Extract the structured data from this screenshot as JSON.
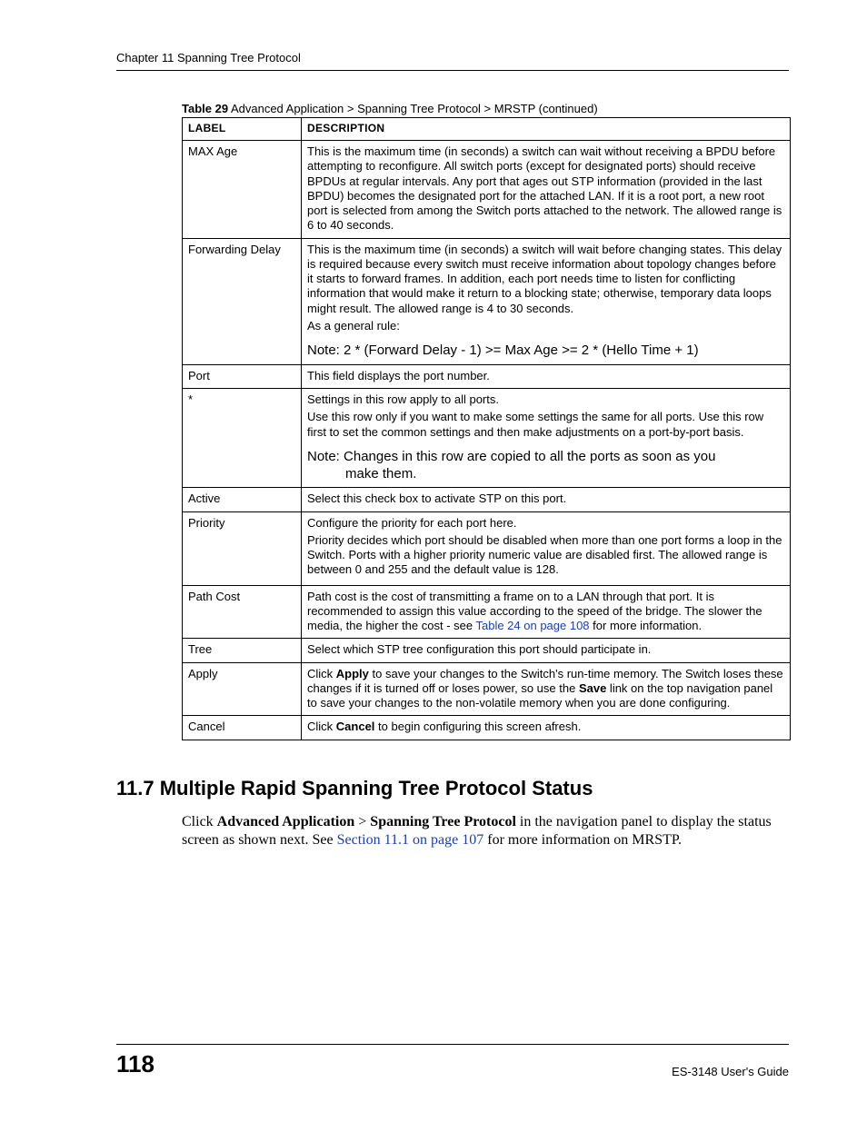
{
  "header": {
    "running": "Chapter 11 Spanning Tree Protocol"
  },
  "table": {
    "caption_bold": "Table 29",
    "caption_rest": "   Advanced Application > Spanning Tree Protocol > MRSTP  (continued)",
    "head_label": "LABEL",
    "head_desc": "DESCRIPTION",
    "rows": [
      {
        "label": "MAX Age",
        "desc_plain": "This is the maximum time (in seconds) a switch can wait without receiving a BPDU before attempting to reconfigure. All switch ports (except for designated ports) should receive BPDUs at regular intervals. Any port that ages out STP information (provided in the last BPDU) becomes the designated port for the attached LAN. If it is a root port, a new root port is selected from among the Switch ports attached to the network. The allowed range is 6 to 40 seconds."
      },
      {
        "label": "Forwarding Delay",
        "desc_p1": "This is the maximum time (in seconds) a switch will wait before changing states. This delay is required because every switch must receive information about topology changes before it starts to forward frames. In addition, each port needs time to listen for conflicting information that would make it return to a blocking state; otherwise, temporary data loops might result. The allowed range is 4 to 30 seconds.",
        "desc_p2": "As a general rule:",
        "note": "Note: 2 * (Forward Delay - 1) >= Max Age >= 2 * (Hello Time + 1)"
      },
      {
        "label": "Port",
        "desc_plain": "This field displays the port number."
      },
      {
        "label": "*",
        "desc_p1": "Settings in this row apply to all ports.",
        "desc_p2": "Use this row only if you want to make some settings the same for all ports. Use this row first to set the common settings and then make adjustments on a port-by-port basis.",
        "note_l1": "Note: Changes in this row are copied to all the ports as soon as you",
        "note_l2": "make them."
      },
      {
        "label": "Active",
        "desc_plain": "Select this check box to activate STP on this port."
      },
      {
        "label": "Priority",
        "desc_p1": "Configure the priority for each port here.",
        "desc_p2": "Priority decides which port should be disabled when more than one port forms a loop in the Switch. Ports with a higher priority numeric value are disabled first. The allowed range is between 0 and 255 and the default value is 128."
      },
      {
        "label": "Path Cost",
        "desc_pre": "Path cost is the cost of transmitting a frame on to a LAN through that port. It is recommended to assign this value according to the speed of the bridge. The slower the media, the higher the cost - see ",
        "link": "Table 24 on page 108",
        "desc_post": " for more information."
      },
      {
        "label": "Tree",
        "desc_plain": "Select which STP tree configuration this port should participate in."
      },
      {
        "label": "Apply",
        "pre1": "Click ",
        "b1": "Apply",
        "mid1": " to save your changes to the Switch's run-time memory. The Switch loses these changes if it is turned off or loses power, so use the ",
        "b2": "Save",
        "post1": " link on the top navigation panel to save your changes to the non-volatile memory when you are done configuring."
      },
      {
        "label": "Cancel",
        "pre1": "Click ",
        "b1": "Cancel",
        "post1": " to begin configuring this screen afresh."
      }
    ]
  },
  "section": {
    "heading": "11.7  Multiple Rapid Spanning Tree Protocol Status",
    "para_pre": "Click ",
    "b1": "Advanced Application",
    "gt": " > ",
    "b2": "Spanning Tree Protocol",
    "para_mid": " in the navigation panel to display the status screen as shown next. See ",
    "link": "Section 11.1 on page 107",
    "para_post": " for more information on MRSTP."
  },
  "footer": {
    "page": "118",
    "guide": "ES-3148 User's Guide"
  }
}
